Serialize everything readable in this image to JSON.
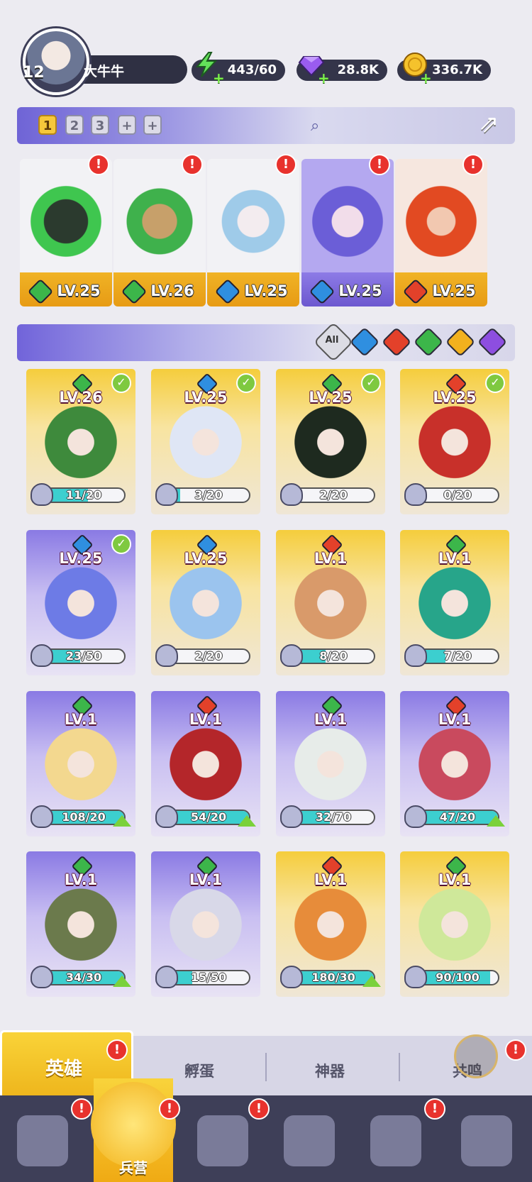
{
  "player": {
    "level": "12",
    "name": "大牛牛"
  },
  "resources": {
    "energy": "443/60",
    "gems": "28.8K",
    "coins": "336.7K"
  },
  "team_tabs": [
    "1",
    "2",
    "3",
    "+",
    "+"
  ],
  "team": [
    {
      "lv": "LV.25",
      "elem": "g"
    },
    {
      "lv": "LV.26",
      "elem": "g"
    },
    {
      "lv": "LV.25",
      "elem": "b"
    },
    {
      "lv": "LV.25",
      "elem": "b"
    },
    {
      "lv": "LV.25",
      "elem": "r"
    }
  ],
  "filter": {
    "all": "All"
  },
  "heroes": [
    {
      "lv": "LV.26",
      "count": "11/20",
      "fill": 0.55,
      "elem": "g",
      "style": "gold",
      "check": true
    },
    {
      "lv": "LV.25",
      "count": "3/20",
      "fill": 0.15,
      "elem": "b",
      "style": "gold",
      "check": true
    },
    {
      "lv": "LV.25",
      "count": "2/20",
      "fill": 0.1,
      "elem": "g",
      "style": "gold",
      "check": true
    },
    {
      "lv": "LV.25",
      "count": "0/20",
      "fill": 0,
      "elem": "r",
      "style": "gold",
      "check": true
    },
    {
      "lv": "LV.25",
      "count": "23/50",
      "fill": 0.46,
      "elem": "b",
      "style": "purple",
      "check": true
    },
    {
      "lv": "LV.25",
      "count": "2/20",
      "fill": 0.1,
      "elem": "b",
      "style": "gold"
    },
    {
      "lv": "LV.1",
      "count": "8/20",
      "fill": 0.4,
      "elem": "r",
      "style": "gold"
    },
    {
      "lv": "LV.1",
      "count": "7/20",
      "fill": 0.35,
      "elem": "g",
      "style": "gold"
    },
    {
      "lv": "LV.1",
      "count": "108/20",
      "fill": 1,
      "elem": "g",
      "style": "purple",
      "up": true
    },
    {
      "lv": "LV.1",
      "count": "54/20",
      "fill": 1,
      "elem": "r",
      "style": "purple",
      "up": true
    },
    {
      "lv": "LV.1",
      "count": "32/70",
      "fill": 0.46,
      "elem": "g",
      "style": "purple"
    },
    {
      "lv": "LV.1",
      "count": "47/20",
      "fill": 1,
      "elem": "r",
      "style": "purple",
      "up": true
    },
    {
      "lv": "LV.1",
      "count": "34/30",
      "fill": 1,
      "elem": "g",
      "style": "purple",
      "up": true
    },
    {
      "lv": "LV.1",
      "count": "15/50",
      "fill": 0.3,
      "elem": "g",
      "style": "purple"
    },
    {
      "lv": "LV.1",
      "count": "180/30",
      "fill": 1,
      "elem": "r",
      "style": "gold",
      "up": true
    },
    {
      "lv": "LV.1",
      "count": "90/100",
      "fill": 0.9,
      "elem": "g",
      "style": "gold"
    }
  ],
  "tabs": [
    "英雄",
    "孵蛋",
    "神器",
    "共鸣"
  ],
  "nav": {
    "selected_label": "兵营"
  },
  "colors": {
    "accent": "#f6c83b",
    "purple": "#6c58cf",
    "red_badge": "#e8322d"
  }
}
